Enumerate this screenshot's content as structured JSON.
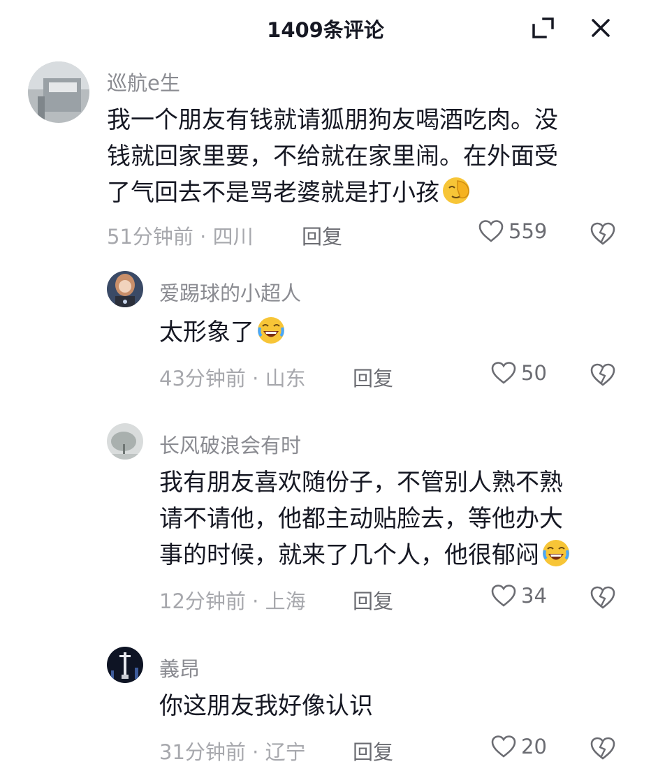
{
  "header": {
    "title": "1409条评论",
    "expand_icon": "collapse-expand-icon",
    "close_icon": "close-icon"
  },
  "comments": [
    {
      "username": "巡航e生",
      "avatar_icon": "avatar-building-photo",
      "lines": [
        "我一个朋友有钱就请狐朋狗友喝酒吃肉。没",
        "钱就回家里要，不给就在家里闹。在外面受",
        "了气回去不是骂老婆就是打小孩"
      ],
      "emoji": "facepalm-emoji",
      "time": "51分钟前",
      "location": "四川",
      "reply_label": "回复",
      "likes": "559"
    },
    {
      "username": "爱踢球的小超人",
      "avatar_icon": "avatar-anime-girl",
      "lines": [
        "太形象了"
      ],
      "emoji": "rofl-emoji",
      "time": "43分钟前",
      "location": "山东",
      "reply_label": "回复",
      "likes": "50"
    },
    {
      "username": "长风破浪会有时",
      "avatar_icon": "avatar-foggy-tree",
      "lines": [
        "我有朋友喜欢随份子，不管别人熟不熟",
        "请不请他，他都主动贴脸去，等他办大",
        "事的时候，就来了几个人，他很郁闷"
      ],
      "emoji": "rofl-emoji",
      "time": "12分钟前",
      "location": "上海",
      "reply_label": "回复",
      "likes": "34"
    },
    {
      "username": "義昂",
      "avatar_icon": "avatar-monument-night",
      "lines": [
        "你这朋友我好像认识"
      ],
      "emoji": "",
      "time": "31分钟前",
      "location": "辽宁",
      "reply_label": "回复",
      "likes": "20"
    }
  ],
  "meta_separator": "·",
  "icons": {
    "like": "heart-outline-icon",
    "dislike": "broken-heart-icon"
  },
  "colors": {
    "text": "#161823",
    "muted": "#8a8b91",
    "meta": "#a7a8ad",
    "emoji": "#f7c537"
  }
}
